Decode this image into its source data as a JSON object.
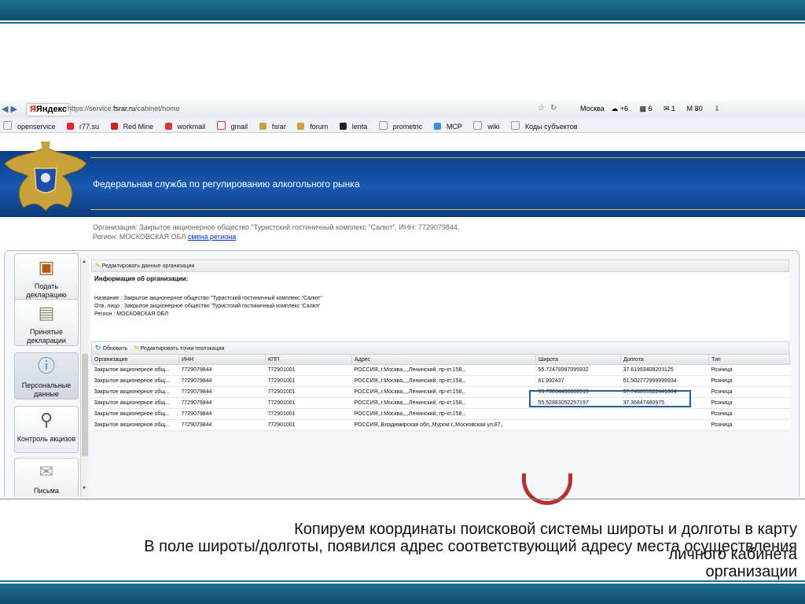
{
  "browser": {
    "search_engine": "Яндекс",
    "url_prefix": "https://service.",
    "url_domain": "fsrar.ru",
    "url_path": "/cabinet/home",
    "right_toolbar": [
      "Москва",
      "+6",
      "6",
      "1",
      "80"
    ],
    "bookmarks": [
      "openservice",
      "r77.su",
      "Red Mine",
      "workmail",
      "gmail",
      "fsrar",
      "forum",
      "lenta",
      "prometric",
      "MCP",
      "wiki",
      "Коды субъектов"
    ]
  },
  "site": {
    "title": "Федеральная служба по регулированию алкогольного рынка",
    "org_line": "Организация: Закрытое акционерное общество \"Туристский гостиничный комплекс \"Салют\", ИНН: 7729079844,",
    "region_line": "Регион: МОСКОВСКАЯ ОБЛ",
    "change_region_link": "смена региона"
  },
  "sidebar": {
    "items": [
      {
        "label": "Подать декларацию"
      },
      {
        "label": "Принятые декларации"
      },
      {
        "label": "Персональные данные"
      },
      {
        "label": "Контроль акцизов"
      },
      {
        "label": "Письма"
      }
    ]
  },
  "org_panel": {
    "edit_button": "Редактировать данные организации",
    "heading": "Информация об организации:",
    "name_line": "Название : Закрытое акционерное общество \"Туристский гостиничный комплекс \"Салют\"",
    "contact_line": "Отв. лицо : Закрытое акционерное общество 'Туристский гостиничный комплекс 'Салют'",
    "region_line": "Регион : МОСКОВСКАЯ ОБЛ"
  },
  "grid": {
    "refresh_button": "Обновить",
    "edit_geo_button": "Редактировать точки геолокации",
    "columns": [
      "Организация",
      "ИНН",
      "КПП",
      "Адрес",
      "Широта",
      "Долгота",
      "Тип"
    ],
    "rows": [
      [
        "Закрытое акционерное общ...",
        "7729079844",
        "772901001",
        "РОССИЯ,,г.Москва,,,,Ленинский, пр-кт,158,,",
        "55.72478997095932",
        "37.61993408203125",
        "Розница"
      ],
      [
        "Закрытое акционерное общ...",
        "7729079844",
        "772901001",
        "РОССИЯ,,г.Москва,,,,Ленинский, пр-кт,158,,",
        "61.992437",
        "61.502772999999934",
        "Розница"
      ],
      [
        "Закрытое акционерное общ...",
        "7729079844",
        "772901001",
        "РОССИЯ,,г.Москва,,,,Ленинский, пр-кт,158,,",
        "55.73064436886915",
        "37.743055522441864",
        "Розница"
      ],
      [
        "Закрытое акционерное общ...",
        "7729079844",
        "772901001",
        "РОССИЯ,,г.Москва,,,,Ленинский, пр-кт,158,,",
        "55.52883052257197",
        "37.36847480975",
        "Розница"
      ],
      [
        "Закрытое акционерное общ...",
        "7729079844",
        "772901001",
        "РОССИЯ,,г.Москва,,,,Ленинский, пр-кт,158,,",
        "",
        "",
        "Розница"
      ],
      [
        "Закрытое акционерное общ...",
        "7729079844",
        "772901001",
        "РОССИЯ,,Владимирская обл,,Муром г,,Московская ул,87,,",
        "",
        "",
        "Розница"
      ]
    ]
  },
  "captions": {
    "line1": "Копируем координаты поисковой системы широты и долготы в карту",
    "line2": "В поле широты/долготы, появился адрес соответствующий адресу места осуществления",
    "line3": "личного кабинета",
    "line4": "организации"
  },
  "colors": {
    "band": "#1d6f92",
    "site_header": "#1659b0",
    "highlight_box": "#1f5f9a",
    "link": "#0033cc"
  }
}
